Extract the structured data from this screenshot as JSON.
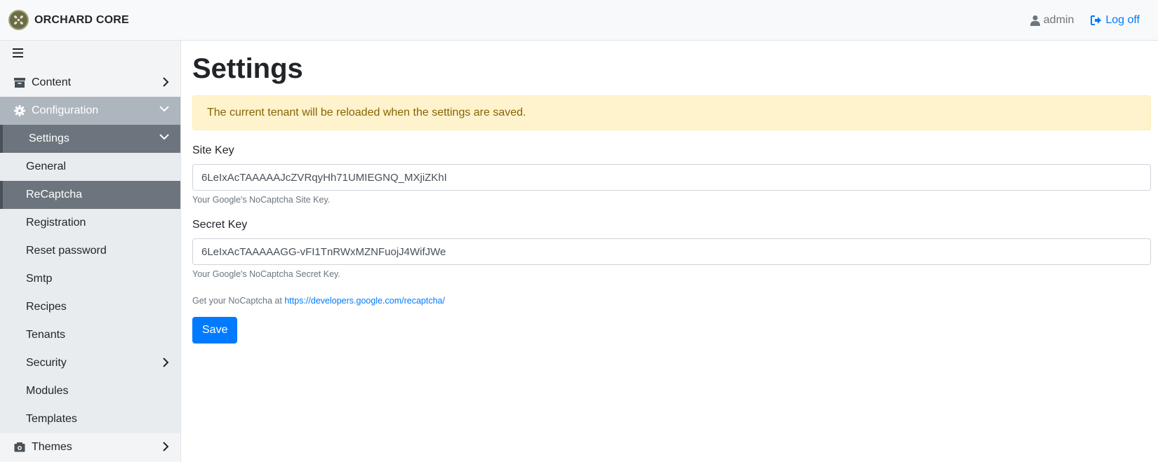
{
  "header": {
    "brand": "ORCHARD CORE",
    "user": "admin",
    "logoff": "Log off"
  },
  "sidebar": {
    "items": [
      {
        "label": "Content",
        "icon": "archive-icon"
      },
      {
        "label": "Configuration",
        "icon": "gear-icon"
      },
      {
        "label": "Settings"
      },
      {
        "label": "General"
      },
      {
        "label": "ReCaptcha"
      },
      {
        "label": "Registration"
      },
      {
        "label": "Reset password"
      },
      {
        "label": "Smtp"
      },
      {
        "label": "Recipes"
      },
      {
        "label": "Tenants"
      },
      {
        "label": "Security"
      },
      {
        "label": "Modules"
      },
      {
        "label": "Templates"
      },
      {
        "label": "Themes",
        "icon": "themes-icon"
      }
    ]
  },
  "main": {
    "title": "Settings",
    "alert": "The current tenant will be reloaded when the settings are saved.",
    "site_key": {
      "label": "Site Key",
      "value": "6LeIxAcTAAAAAJcZVRqyHh71UMIEGNQ_MXjiZKhI",
      "hint": "Your Google's NoCaptcha Site Key."
    },
    "secret_key": {
      "label": "Secret Key",
      "value": "6LeIxAcTAAAAAGG-vFI1TnRWxMZNFuojJ4WifJWe",
      "hint": "Your Google's NoCaptcha Secret Key."
    },
    "get_text": "Get your NoCaptcha at",
    "get_link": "https://developers.google.com/recaptcha/",
    "save_label": "Save"
  },
  "colors": {
    "primary": "#007bff",
    "alert_bg": "#fff3cd",
    "sidebar_active": "#6c757d",
    "sidebar_section": "#adb5bd"
  }
}
